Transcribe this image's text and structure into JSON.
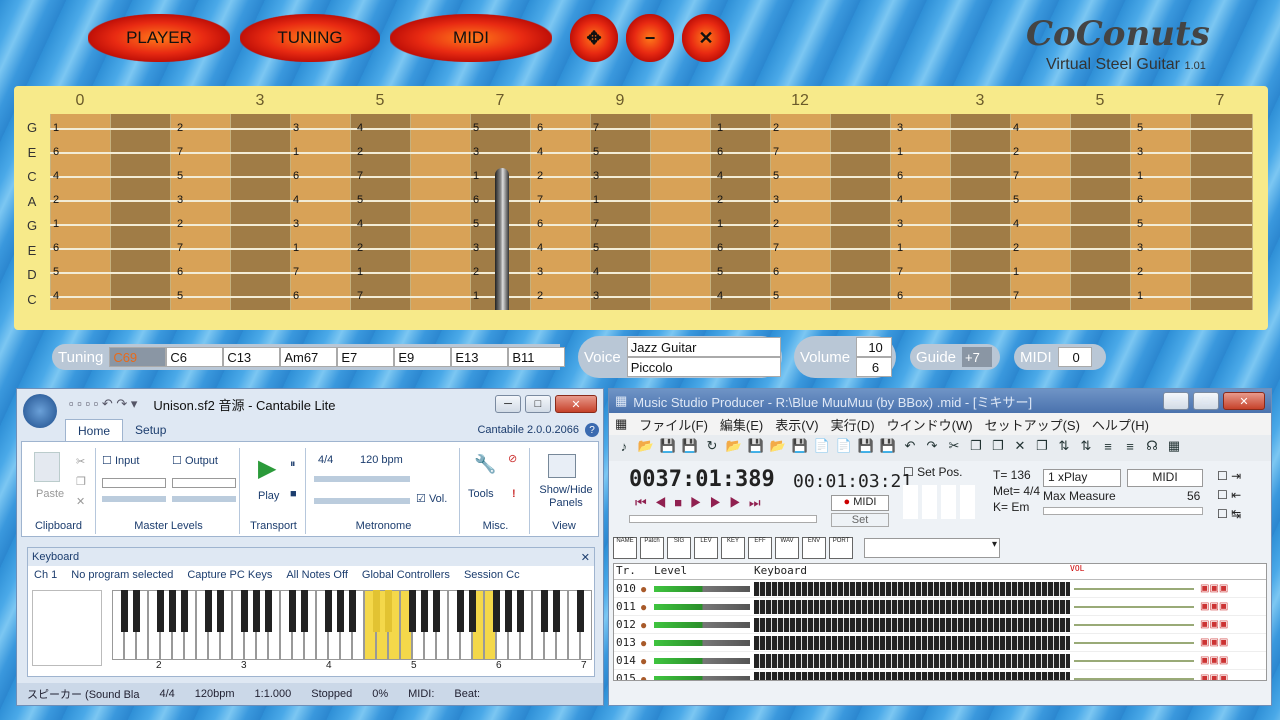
{
  "app": {
    "buttons": [
      "PLAYER",
      "TUNING",
      "MIDI"
    ],
    "icon_buttons": [
      "move-icon",
      "minimize-icon",
      "close-icon"
    ],
    "icon_glyphs": [
      "✥",
      "−",
      "✕"
    ],
    "logo": "CoConuts",
    "subtitle": "Virtual Steel Guitar",
    "version": "1.01"
  },
  "fretboard": {
    "fret_labels": [
      "0",
      "3",
      "5",
      "7",
      "9",
      "12",
      "3",
      "5",
      "7"
    ],
    "strings": [
      "G",
      "E",
      "C",
      "A",
      "G",
      "E",
      "D",
      "C"
    ],
    "rows": [
      [
        "1",
        "2",
        "3",
        "4",
        "5",
        "6",
        "7",
        "1",
        "2",
        "3",
        "4",
        "5"
      ],
      [
        "6",
        "7",
        "1",
        "2",
        "3",
        "4",
        "5",
        "6",
        "7",
        "1",
        "2",
        "3"
      ],
      [
        "4",
        "5",
        "6",
        "7",
        "1",
        "2",
        "3",
        "4",
        "5",
        "6",
        "7",
        "1"
      ],
      [
        "2",
        "3",
        "4",
        "5",
        "6",
        "7",
        "1",
        "2",
        "3",
        "4",
        "5",
        "6"
      ],
      [
        "1",
        "2",
        "3",
        "4",
        "5",
        "6",
        "7",
        "1",
        "2",
        "3",
        "4",
        "5"
      ],
      [
        "6",
        "7",
        "1",
        "2",
        "3",
        "4",
        "5",
        "6",
        "7",
        "1",
        "2",
        "3"
      ],
      [
        "5",
        "6",
        "7",
        "1",
        "2",
        "3",
        "4",
        "5",
        "6",
        "7",
        "1",
        "2"
      ],
      [
        "4",
        "5",
        "6",
        "7",
        "1",
        "2",
        "3",
        "4",
        "5",
        "6",
        "7",
        "1"
      ]
    ]
  },
  "tuning": {
    "label": "Tuning",
    "items": [
      "C69",
      "C6",
      "C13",
      "Am67",
      "E7",
      "E9",
      "E13",
      "B11"
    ]
  },
  "voice": {
    "label": "Voice",
    "items": [
      "Jazz  Guitar",
      "Piccolo"
    ]
  },
  "volume": {
    "label": "Volume",
    "values": [
      "10",
      "6"
    ]
  },
  "guide": {
    "label": "Guide",
    "value": "+7"
  },
  "midi": {
    "label": "MIDI",
    "value": "0"
  },
  "cantabile": {
    "title": "Unison.sf2 音源 - Cantabile Lite",
    "tabs": [
      "Home",
      "Setup"
    ],
    "version": "Cantabile 2.0.0.2066",
    "groups": {
      "clipboard": "Clipboard",
      "paste": "Paste",
      "master": "Master Levels",
      "input": "Input",
      "output": "Output",
      "transport": "Transport",
      "play": "Play",
      "metronome": "Metronome",
      "sig": "4/4",
      "bpm": "120 bpm",
      "vol": "Vol.",
      "misc": "Misc.",
      "tools": "Tools",
      "view": "View",
      "showhide": "Show/Hide",
      "panels": "Panels"
    },
    "keyboard": {
      "title": "Keyboard",
      "ch": "Ch 1",
      "program": "No program selected",
      "capture": "Capture PC Keys",
      "notesoff": "All Notes Off",
      "global": "Global Controllers",
      "session": "Session Cc",
      "octaves": [
        "2",
        "3",
        "4",
        "5",
        "6",
        "7"
      ]
    },
    "status": [
      "スピーカー (Sound Bla",
      "4/4",
      "120bpm",
      "1:1.000",
      "Stopped",
      "0%",
      "MIDI:",
      "Beat:"
    ]
  },
  "msp": {
    "title": "Music Studio Producer - R:\\Blue MuuMuu (by BBox) .mid - [ミキサー]",
    "menu": [
      "ファイル(F)",
      "編集(E)",
      "表示(V)",
      "実行(D)",
      "ウインドウ(W)",
      "セットアップ(S)",
      "ヘルプ(H)"
    ],
    "time": "0037:01:389",
    "clock": "00:01:03:21",
    "midi_btn": "MIDI",
    "set": "Set",
    "setpos": "Set Pos.",
    "tempo": "T= 136",
    "met": "Met=",
    "met_sig": "4/4",
    "key": "K=  Em",
    "play_mode": "1 xPlay",
    "midi2": "MIDI",
    "maxmeasure": "Max Measure",
    "maxval": "56",
    "tabs": [
      "NAME",
      "Patch",
      "SIG",
      "LEV",
      "KEY",
      "EFF",
      "WAV",
      "ENV",
      "PORT"
    ],
    "cols": [
      "Tr.",
      "Level",
      "Keyboard",
      "VOL"
    ],
    "tracks": [
      "010",
      "011",
      "012",
      "013",
      "014",
      "015"
    ]
  }
}
